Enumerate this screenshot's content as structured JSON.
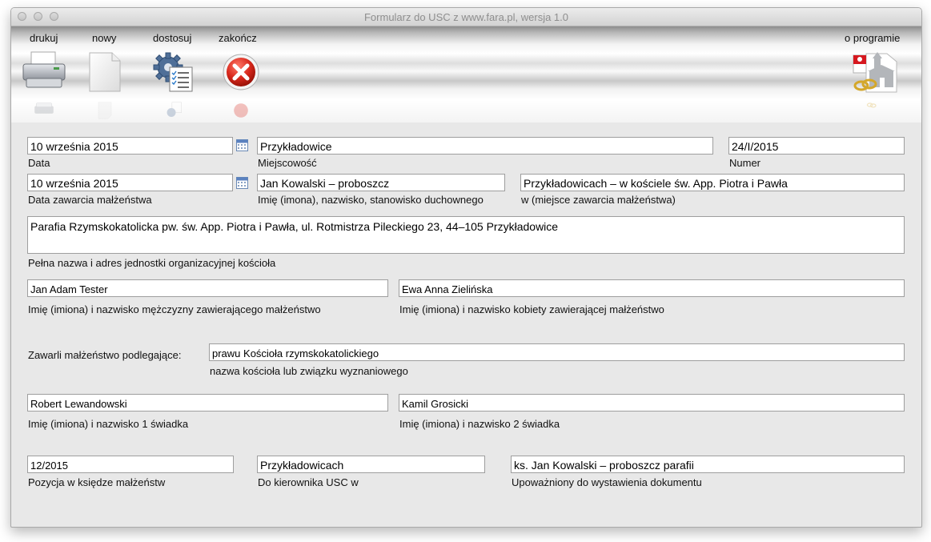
{
  "window": {
    "title": "Formularz do USC z www.fara.pl, wersja 1.0"
  },
  "toolbar": {
    "print_label": "drukuj",
    "new_label": "nowy",
    "settings_label": "dostosuj",
    "quit_label": "zakończ",
    "about_label": "o programie"
  },
  "form": {
    "date": {
      "value": "10 września 2015",
      "caption": "Data"
    },
    "place": {
      "value": "Przykładowice",
      "caption": "Miejscowość"
    },
    "number": {
      "value": "24/I/2015",
      "caption": "Numer"
    },
    "marriage_date": {
      "value": "10 września 2015",
      "caption": "Data zawarcia małżeństwa"
    },
    "clergy": {
      "value": "Jan Kowalski – proboszcz",
      "caption": "Imię (imona), nazwisko, stanowisko duchownego"
    },
    "marriage_place": {
      "value": "Przykładowicach – w kościele św. App. Piotra i Pawła",
      "caption": "w (miejsce zawarcia małżeństwa)"
    },
    "church_unit": {
      "value": "Parafia Rzymskokatolicka pw. św. App. Piotra i Pawła, ul. Rotmistrza Pileckiego 23, 44–105 Przykładowice",
      "caption": "Pełna nazwa i adres jednostki organizacyjnej kościoła"
    },
    "groom": {
      "value": "Jan Adam Tester",
      "caption": "Imię (imiona) i nazwisko mężczyzny zawierającego małżeństwo"
    },
    "bride": {
      "value": "Ewa Anna Zielińska",
      "caption": "Imię (imiona) i nazwisko kobiety zawierającej małżeństwo"
    },
    "subject_to": {
      "label": "Zawarli małżeństwo podlegające:",
      "value": "prawu Kościoła rzymskokatolickiego",
      "caption": "nazwa kościoła lub związku wyznaniowego"
    },
    "witness1": {
      "value": "Robert Lewandowski",
      "caption": "Imię (imiona) i nazwisko 1 świadka"
    },
    "witness2": {
      "value": "Kamil Grosicki",
      "caption": "Imię (imiona) i nazwisko 2 świadka"
    },
    "register_position": {
      "value": "12/2015",
      "caption": "Pozycja w księdze małżeństw"
    },
    "usc_head": {
      "value": "Przykładowicach",
      "caption": "Do kierownika USC w"
    },
    "authorized": {
      "value": "ks. Jan Kowalski – proboszcz parafii",
      "caption": "Upoważniony do wystawienia dokumentu"
    }
  }
}
